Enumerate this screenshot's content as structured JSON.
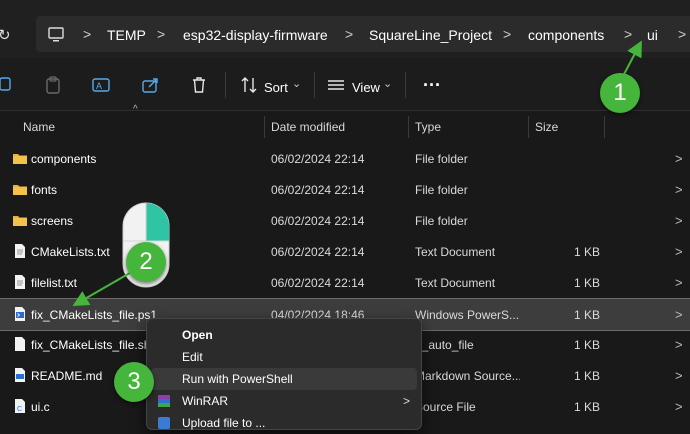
{
  "address_bar": {
    "crumbs": [
      "TEMP",
      "esp32-display-firmware",
      "SquareLine_Project",
      "components",
      "ui"
    ],
    "separator": ">"
  },
  "toolbar": {
    "sort_label": "Sort",
    "view_label": "View",
    "more_label": "···",
    "chevron": "⌄"
  },
  "columns": {
    "name": "Name",
    "date": "Date modified",
    "type": "Type",
    "size": "Size"
  },
  "files": [
    {
      "name": "components",
      "date": "06/02/2024 22:14",
      "type": "File folder",
      "size": "",
      "icon": "folder-icon"
    },
    {
      "name": "fonts",
      "date": "06/02/2024 22:14",
      "type": "File folder",
      "size": "",
      "icon": "folder-icon"
    },
    {
      "name": "screens",
      "date": "06/02/2024 22:14",
      "type": "File folder",
      "size": "",
      "icon": "folder-icon"
    },
    {
      "name": "CMakeLists.txt",
      "date": "06/02/2024 22:14",
      "type": "Text Document",
      "size": "1 KB",
      "icon": "text-file-icon"
    },
    {
      "name": "filelist.txt",
      "date": "06/02/2024 22:14",
      "type": "Text Document",
      "size": "1 KB",
      "icon": "text-file-icon"
    },
    {
      "name": "fix_CMakeLists_file.ps1",
      "date": "04/02/2024 18:46",
      "type": "Windows PowerS...",
      "size": "1 KB",
      "icon": "powershell-file-icon",
      "selected": true
    },
    {
      "name": "fix_CMakeLists_file.sh",
      "date": "",
      "type": "h_auto_file",
      "size": "1 KB",
      "icon": "shell-file-icon"
    },
    {
      "name": "README.md",
      "date": "",
      "type": "Markdown Source...",
      "size": "1 KB",
      "icon": "markdown-file-icon"
    },
    {
      "name": "ui.c",
      "date": "",
      "type": "Source File",
      "size": "1 KB",
      "icon": "c-file-icon"
    }
  ],
  "context_menu": {
    "open": "Open",
    "edit": "Edit",
    "run_powershell": "Run with PowerShell",
    "winrar": "WinRAR",
    "submenu_arrow": ">",
    "partial": "Upload file to ..."
  },
  "annotations": {
    "step1": "1",
    "step2": "2",
    "step3": "3"
  },
  "colors": {
    "accent_green": "#46b53c",
    "folder_yellow": "#e8b23a",
    "selection": "#3d3d3d",
    "mouse_highlight": "#2ec4a4"
  }
}
